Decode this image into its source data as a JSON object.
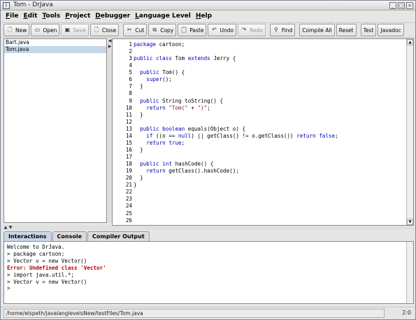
{
  "window": {
    "title": "Tom - DrJava"
  },
  "menu": [
    {
      "label_ul": "F",
      "label_rest": "ile"
    },
    {
      "label_ul": "E",
      "label_rest": "dit"
    },
    {
      "label_ul": "T",
      "label_rest": "ools"
    },
    {
      "label_ul": "P",
      "label_rest": "roject"
    },
    {
      "label_ul": "D",
      "label_rest": "ebugger"
    },
    {
      "label_ul": "L",
      "label_rest": "anguage Level"
    },
    {
      "label_ul": "H",
      "label_rest": "elp"
    }
  ],
  "toolbar": {
    "new": "New",
    "open": "Open",
    "save": "Save",
    "close": "Close",
    "cut": "Cut",
    "copy": "Copy",
    "paste": "Paste",
    "undo": "Undo",
    "redo": "Redo",
    "find": "Find",
    "compile_all": "Compile All",
    "reset": "Reset",
    "test": "Test",
    "javadoc": "Javadoc"
  },
  "files": [
    {
      "name": "Bart.java",
      "selected": false
    },
    {
      "name": "Tom.java",
      "selected": true
    }
  ],
  "editor": {
    "line_numbers": [
      "1",
      "2",
      "3",
      "4",
      "5",
      "6",
      "7",
      "8",
      "9",
      "10",
      "11",
      "12",
      "13",
      "14",
      "15",
      "16",
      "17",
      "18",
      "19",
      "20",
      "21",
      "22",
      "23",
      "24",
      "25",
      "26"
    ],
    "lines": [
      "package cartoon;",
      "",
      "public class Tom extends Jerry {",
      "",
      "  public Tom() {",
      "    super();",
      "  }",
      "",
      "  public String toString() {",
      "    return \"Tom(\" + \")\";",
      "  }",
      "",
      "  public boolean equals(Object o) {",
      "    if ((o == null) || getClass() != o.getClass()) return false;",
      "    return true;",
      "  }",
      "",
      "  public int hashCode() {",
      "    return getClass().hashCode();",
      "  }",
      "}",
      "",
      "",
      "",
      "",
      ""
    ]
  },
  "tabs": {
    "interactions": "Interactions",
    "console": "Console",
    "compiler_output": "Compiler Output"
  },
  "interactions": [
    {
      "text": "Welcome to DrJava.",
      "error": false
    },
    {
      "text": "> package cartoon;",
      "error": false
    },
    {
      "text": "> Vector v = new Vector()",
      "error": false
    },
    {
      "text": "Error: Undefined class 'Vector'",
      "error": true
    },
    {
      "text": "> import java.util.*;",
      "error": false
    },
    {
      "text": "> Vector v = new Vector()",
      "error": false
    },
    {
      "text": ">",
      "error": false
    }
  ],
  "status": {
    "path": "/home/elspeth/javalanglevelsNew/testFiles/Tom.java",
    "position": "2:0"
  }
}
